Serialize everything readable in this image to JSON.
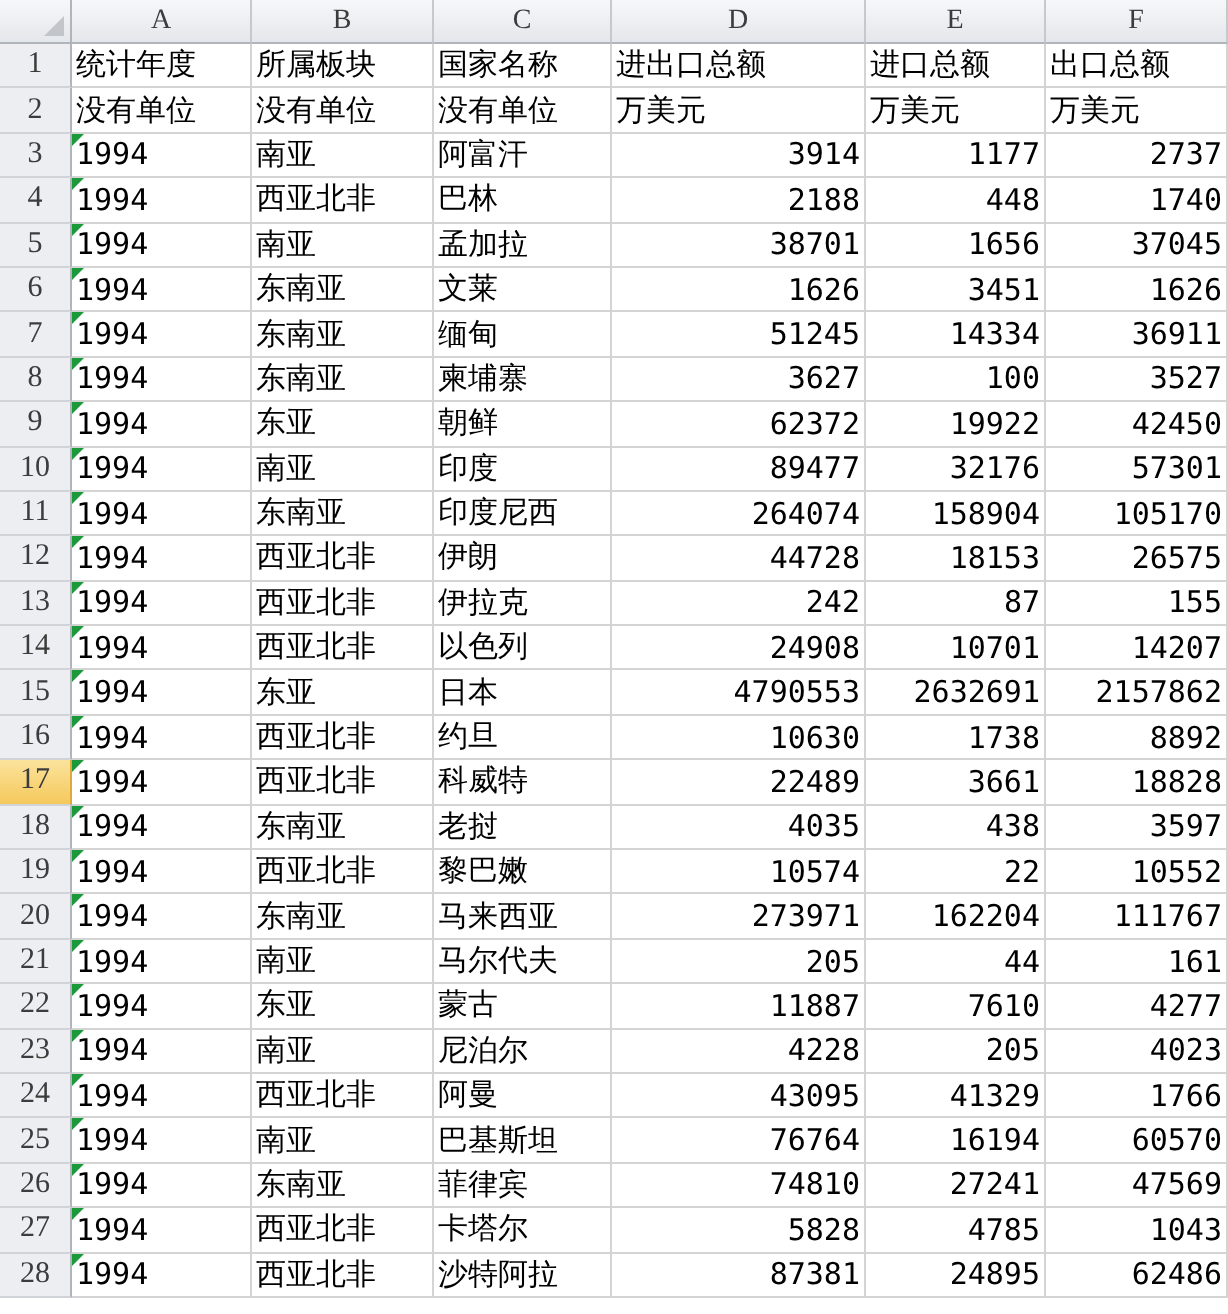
{
  "columns": [
    {
      "label": "A",
      "numeric": false
    },
    {
      "label": "B",
      "numeric": false
    },
    {
      "label": "C",
      "numeric": false
    },
    {
      "label": "D",
      "numeric": true
    },
    {
      "label": "E",
      "numeric": true
    },
    {
      "label": "F",
      "numeric": true
    }
  ],
  "rows": [
    {
      "number": "1",
      "selected": false,
      "kind": "text",
      "cells": [
        "统计年度",
        "所属板块",
        "国家名称",
        "进出口总额",
        "进口总额",
        "出口总额"
      ]
    },
    {
      "number": "2",
      "selected": false,
      "kind": "text",
      "cells": [
        "没有单位",
        "没有单位",
        "没有单位",
        "万美元",
        "万美元",
        "万美元"
      ]
    },
    {
      "number": "3",
      "selected": false,
      "kind": "record",
      "cells": [
        "1994",
        "南亚",
        "阿富汗",
        "3914",
        "1177",
        "2737"
      ]
    },
    {
      "number": "4",
      "selected": false,
      "kind": "record",
      "cells": [
        "1994",
        "西亚北非",
        "巴林",
        "2188",
        "448",
        "1740"
      ]
    },
    {
      "number": "5",
      "selected": false,
      "kind": "record",
      "cells": [
        "1994",
        "南亚",
        "孟加拉",
        "38701",
        "1656",
        "37045"
      ]
    },
    {
      "number": "6",
      "selected": false,
      "kind": "record",
      "cells": [
        "1994",
        "东南亚",
        "文莱",
        "1626",
        "3451",
        "1626"
      ]
    },
    {
      "number": "7",
      "selected": false,
      "kind": "record",
      "cells": [
        "1994",
        "东南亚",
        "缅甸",
        "51245",
        "14334",
        "36911"
      ]
    },
    {
      "number": "8",
      "selected": false,
      "kind": "record",
      "cells": [
        "1994",
        "东南亚",
        "柬埔寨",
        "3627",
        "100",
        "3527"
      ]
    },
    {
      "number": "9",
      "selected": false,
      "kind": "record",
      "cells": [
        "1994",
        "东亚",
        "朝鲜",
        "62372",
        "19922",
        "42450"
      ]
    },
    {
      "number": "10",
      "selected": false,
      "kind": "record",
      "cells": [
        "1994",
        "南亚",
        "印度",
        "89477",
        "32176",
        "57301"
      ]
    },
    {
      "number": "11",
      "selected": false,
      "kind": "record",
      "cells": [
        "1994",
        "东南亚",
        "印度尼西",
        "264074",
        "158904",
        "105170"
      ]
    },
    {
      "number": "12",
      "selected": false,
      "kind": "record",
      "cells": [
        "1994",
        "西亚北非",
        "伊朗",
        "44728",
        "18153",
        "26575"
      ]
    },
    {
      "number": "13",
      "selected": false,
      "kind": "record",
      "cells": [
        "1994",
        "西亚北非",
        "伊拉克",
        "242",
        "87",
        "155"
      ]
    },
    {
      "number": "14",
      "selected": false,
      "kind": "record",
      "cells": [
        "1994",
        "西亚北非",
        "以色列",
        "24908",
        "10701",
        "14207"
      ]
    },
    {
      "number": "15",
      "selected": false,
      "kind": "record",
      "cells": [
        "1994",
        "东亚",
        "日本",
        "4790553",
        "2632691",
        "2157862"
      ]
    },
    {
      "number": "16",
      "selected": false,
      "kind": "record",
      "cells": [
        "1994",
        "西亚北非",
        "约旦",
        "10630",
        "1738",
        "8892"
      ]
    },
    {
      "number": "17",
      "selected": true,
      "kind": "record",
      "cells": [
        "1994",
        "西亚北非",
        "科威特",
        "22489",
        "3661",
        "18828"
      ]
    },
    {
      "number": "18",
      "selected": false,
      "kind": "record",
      "cells": [
        "1994",
        "东南亚",
        "老挝",
        "4035",
        "438",
        "3597"
      ]
    },
    {
      "number": "19",
      "selected": false,
      "kind": "record",
      "cells": [
        "1994",
        "西亚北非",
        "黎巴嫩",
        "10574",
        "22",
        "10552"
      ]
    },
    {
      "number": "20",
      "selected": false,
      "kind": "record",
      "cells": [
        "1994",
        "东南亚",
        "马来西亚",
        "273971",
        "162204",
        "111767"
      ]
    },
    {
      "number": "21",
      "selected": false,
      "kind": "record",
      "cells": [
        "1994",
        "南亚",
        "马尔代夫",
        "205",
        "44",
        "161"
      ]
    },
    {
      "number": "22",
      "selected": false,
      "kind": "record",
      "cells": [
        "1994",
        "东亚",
        "蒙古",
        "11887",
        "7610",
        "4277"
      ]
    },
    {
      "number": "23",
      "selected": false,
      "kind": "record",
      "cells": [
        "1994",
        "南亚",
        "尼泊尔",
        "4228",
        "205",
        "4023"
      ]
    },
    {
      "number": "24",
      "selected": false,
      "kind": "record",
      "cells": [
        "1994",
        "西亚北非",
        "阿曼",
        "43095",
        "41329",
        "1766"
      ]
    },
    {
      "number": "25",
      "selected": false,
      "kind": "record",
      "cells": [
        "1994",
        "南亚",
        "巴基斯坦",
        "76764",
        "16194",
        "60570"
      ]
    },
    {
      "number": "26",
      "selected": false,
      "kind": "record",
      "cells": [
        "1994",
        "东南亚",
        "菲律宾",
        "74810",
        "27241",
        "47569"
      ]
    },
    {
      "number": "27",
      "selected": false,
      "kind": "record",
      "cells": [
        "1994",
        "西亚北非",
        "卡塔尔",
        "5828",
        "4785",
        "1043"
      ]
    },
    {
      "number": "28",
      "selected": false,
      "kind": "record",
      "cells": [
        "1994",
        "西亚北非",
        "沙特阿拉",
        "87381",
        "24895",
        "62486"
      ]
    }
  ]
}
